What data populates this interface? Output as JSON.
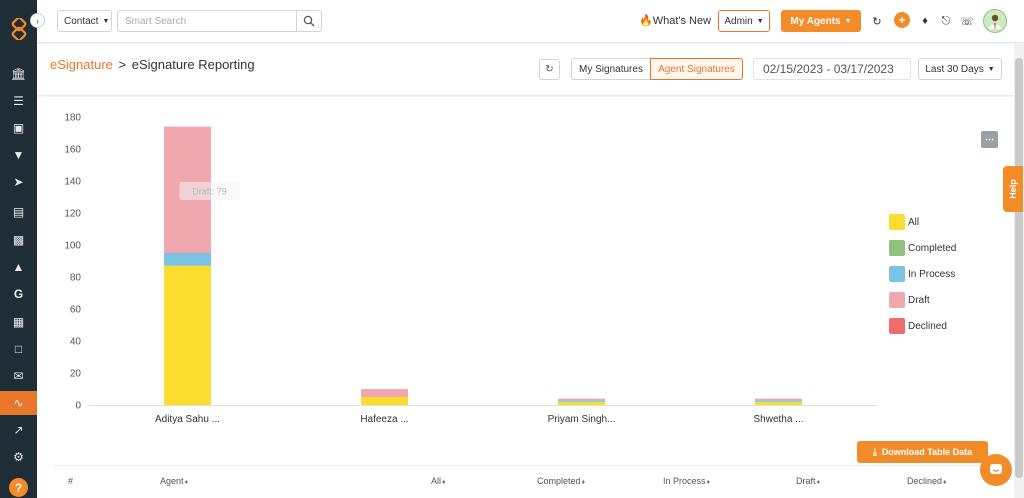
{
  "topbar": {
    "contact_label": "Contact",
    "search_placeholder": "Smart Search",
    "whats_new": "What's New",
    "admin_label": "Admin",
    "my_agents_label": "My Agents"
  },
  "breadcrumb": {
    "parent": "eSignature",
    "separator": ">",
    "current": "eSignature Reporting"
  },
  "toolbar": {
    "seg_my": "My Signatures",
    "seg_agent": "Agent Signatures",
    "date_range": "02/15/2023 - 03/17/2023",
    "period": "Last 30 Days"
  },
  "colors": {
    "accent": "#f28c28",
    "all": "#fcdc2e",
    "completed": "#8fc27a",
    "in_process": "#7cc3e3",
    "draft": "#f0a8ae",
    "declined": "#ef6b6f"
  },
  "chart_data": {
    "type": "bar",
    "stacked": true,
    "categories": [
      "Aditya Sahu ...",
      "Hafeeza ...",
      "Priyam Singh...",
      "Shwetha ..."
    ],
    "series": [
      {
        "name": "All",
        "values": [
          87,
          5,
          2,
          2
        ]
      },
      {
        "name": "Completed",
        "values": [
          0,
          0,
          0,
          0
        ]
      },
      {
        "name": "In Process",
        "values": [
          8,
          0,
          1,
          1
        ]
      },
      {
        "name": "Draft",
        "values": [
          79,
          5,
          1,
          1
        ]
      },
      {
        "name": "Declined",
        "values": [
          0,
          0,
          0,
          0
        ]
      }
    ],
    "yticks": [
      0,
      20,
      40,
      60,
      80,
      100,
      120,
      140,
      160,
      180
    ],
    "ylim": [
      0,
      180
    ],
    "legend_position": "right",
    "tooltip": "Draft: 79"
  },
  "download_label": "Download Table Data",
  "table": {
    "columns": [
      "#",
      "Agent",
      "All",
      "Completed",
      "In Process",
      "Draft",
      "Declined"
    ]
  },
  "help_tab": "Help"
}
